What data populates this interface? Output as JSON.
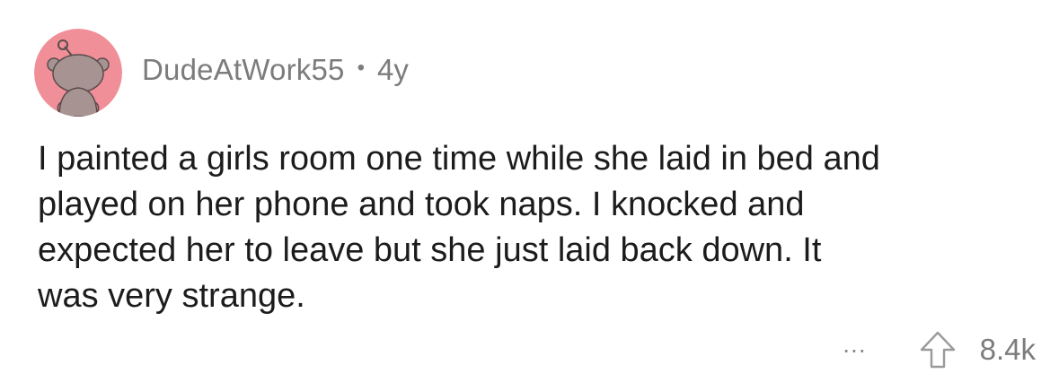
{
  "comment": {
    "author": "DudeAtWork55",
    "separator": "•",
    "age": "4y",
    "body_lines": [
      "I painted a girls room one time while she laid in bed and",
      "played on her phone and took naps. I knocked and",
      "expected her to leave but she just laid back down. It",
      "was very strange."
    ],
    "more_label": "...",
    "score": "8.4k",
    "icons": {
      "avatar": "snoo-avatar-icon",
      "upvote": "upvote-arrow-icon"
    },
    "colors": {
      "avatar_bg": "#f08f97",
      "avatar_figure": "#a89393",
      "meta_text": "#7c7c7c",
      "body_text": "#1c1c1c"
    }
  }
}
